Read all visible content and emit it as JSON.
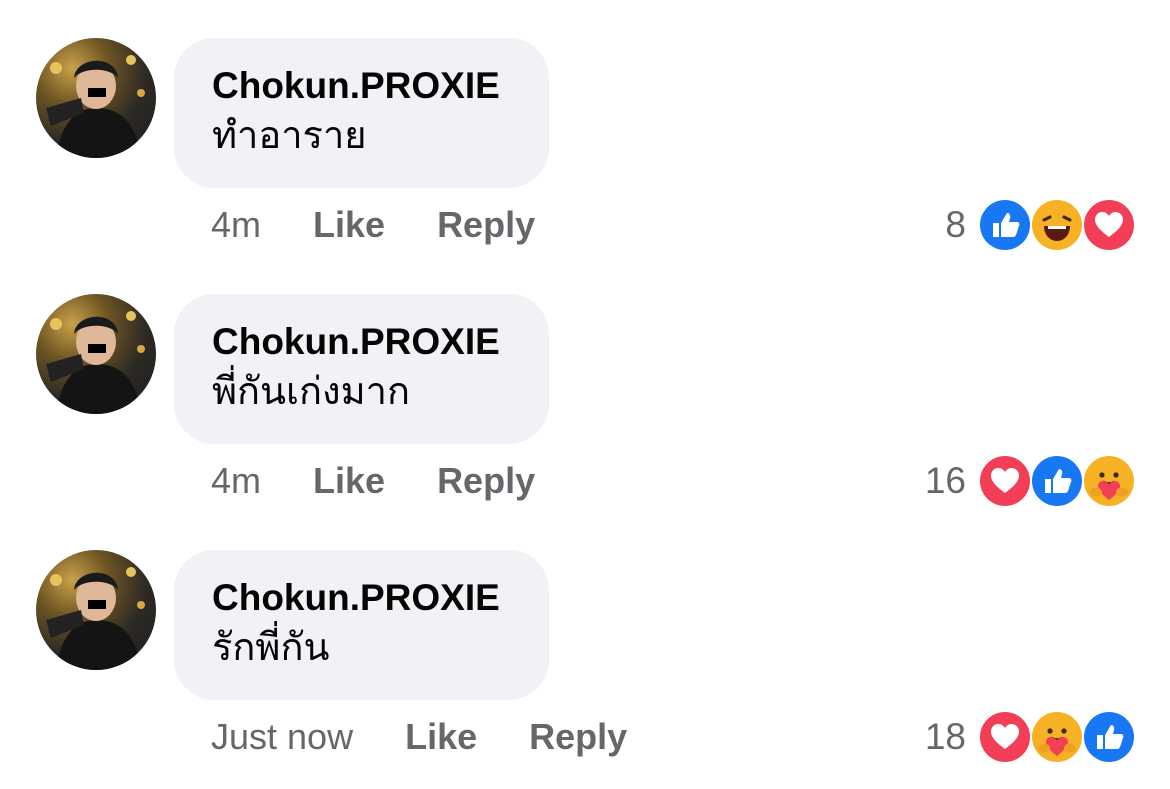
{
  "comments": [
    {
      "author": "Chokun.PROXIE",
      "text": "ทำอาราย",
      "time": "4m",
      "like_label": "Like",
      "reply_label": "Reply",
      "reaction_count": "8",
      "reactions": [
        "like-icon",
        "haha-icon",
        "love-icon"
      ]
    },
    {
      "author": "Chokun.PROXIE",
      "text": "พี่กันเก่งมาก",
      "time": "4m",
      "like_label": "Like",
      "reply_label": "Reply",
      "reaction_count": "16",
      "reactions": [
        "love-icon",
        "like-icon",
        "care-icon"
      ]
    },
    {
      "author": "Chokun.PROXIE",
      "text": "รักพี่กัน",
      "time": "Just now",
      "like_label": "Like",
      "reply_label": "Reply",
      "reaction_count": "18",
      "reactions": [
        "love-icon",
        "care-icon",
        "like-icon"
      ]
    }
  ],
  "colors": {
    "like": "#1877f2",
    "love": "#f33e58",
    "haha": "#f7b125",
    "bubble": "#f0f2f5",
    "meta_text": "#65676b"
  }
}
